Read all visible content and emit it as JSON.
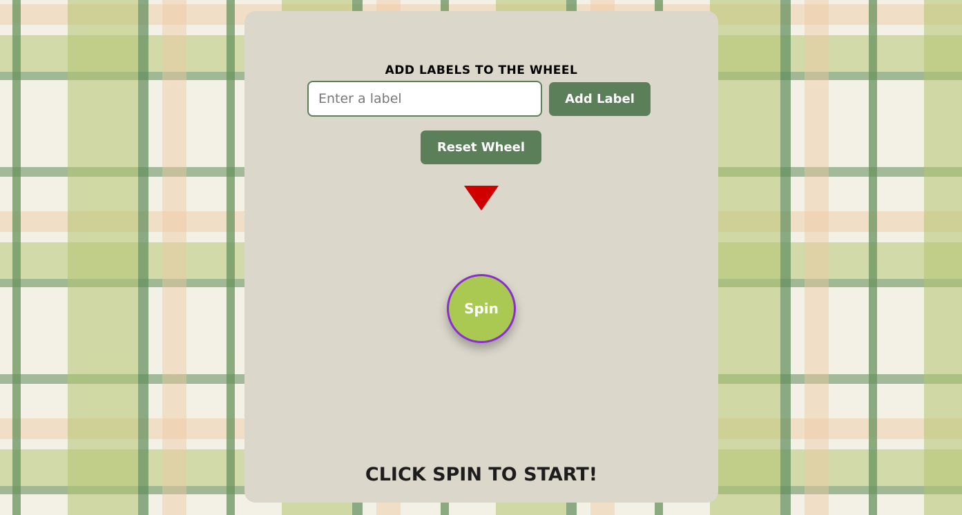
{
  "heading": "ADD LABELS TO THE WHEEL",
  "label_input": {
    "value": "",
    "placeholder": "Enter a label"
  },
  "buttons": {
    "add_label": "Add Label",
    "reset_wheel": "Reset Wheel",
    "spin": "Spin"
  },
  "status_text": "CLICK SPIN TO START!",
  "icons": {
    "pointer": "triangle-down-icon"
  },
  "colors": {
    "panel_bg": "#dbd7cb",
    "button_bg": "#5b7f58",
    "spin_bg": "#a9c952",
    "spin_border": "#8a2dd1",
    "pointer": "#d10000"
  }
}
